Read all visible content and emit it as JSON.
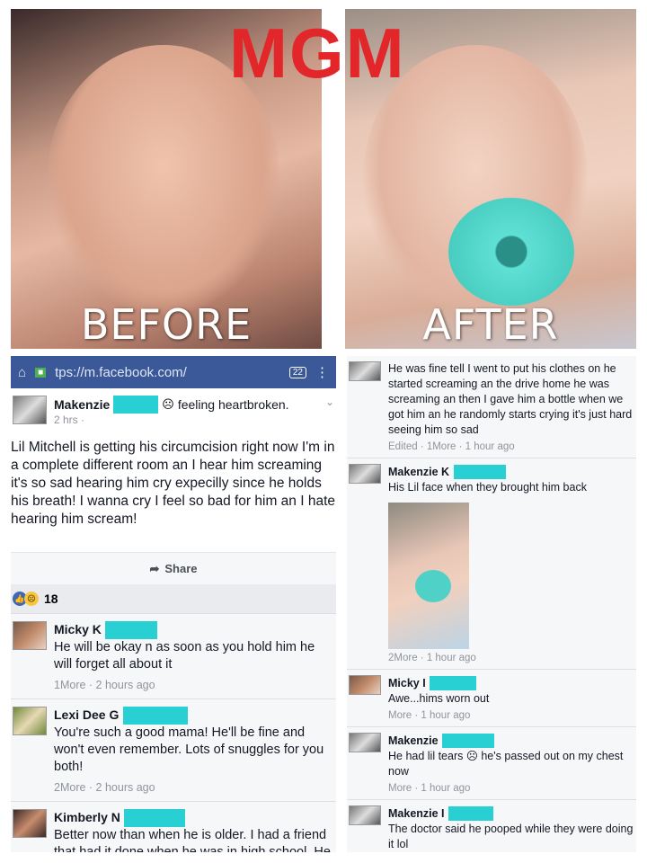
{
  "watermark": "MGM",
  "photos": {
    "before_label": "BEFORE",
    "after_label": "AFTER"
  },
  "browser": {
    "url": "tps://m.facebook.com/",
    "tab_count": "22"
  },
  "post": {
    "author": "Makenzie",
    "feeling": "feeling heartbroken.",
    "time": "2 hrs ·",
    "text": "Lil Mitchell is getting his circumcision right now I'm in a complete different room an I hear him screaming it's so sad hearing him cry expecilly since he holds his breath! I wanna cry I feel so bad for him an I hate hearing him scream!",
    "share_label": "Share",
    "reaction_count": "18"
  },
  "left_comments": [
    {
      "name": "Micky K",
      "text": "He will be okay n as soon as you hold him he will forget all about it",
      "meta": "1More · 2 hours ago"
    },
    {
      "name": "Lexi Dee G",
      "text": "You're such a good mama! He'll be fine and won't even remember. Lots of snuggles for you both!",
      "meta": "2More · 2 hours ago"
    },
    {
      "name": "Kimberly N",
      "text": "Better now than when he is older. I had a friend that had it done when he was in high school. He",
      "meta": ""
    }
  ],
  "right_comments": [
    {
      "name": "",
      "text": "He was fine tell I went to put his clothes on he started screaming an the drive home he was screaming an then I gave him a bottle when we got him an he randomly starts crying it's just hard seeing him so sad",
      "meta": "Edited · 1More · 1 hour ago"
    },
    {
      "name": "Makenzie K",
      "text": "His Lil face when they brought him back",
      "meta": "2More · 1 hour ago"
    },
    {
      "name": "Micky I",
      "text": "Awe...hims worn out",
      "meta": "More · 1 hour ago"
    },
    {
      "name": "Makenzie",
      "text": "He had lil tears ☹ he's passed out on my chest now",
      "meta": "More · 1 hour ago"
    },
    {
      "name": "Makenzie I",
      "text": "The doctor said he pooped while they were doing it lol",
      "meta": ""
    }
  ]
}
